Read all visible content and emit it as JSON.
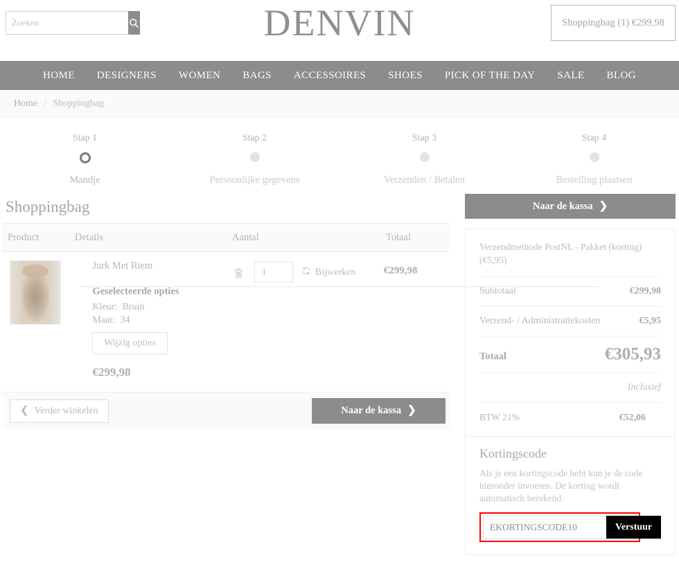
{
  "header": {
    "logo": "DENVIN",
    "search_placeholder": "Zoeken",
    "search_value": "",
    "search_icon": "search-icon",
    "bag_summary": "Shoppingbag (1) €299,98"
  },
  "nav": {
    "items": [
      {
        "label": "HOME"
      },
      {
        "label": "DESIGNERS"
      },
      {
        "label": "WOMEN"
      },
      {
        "label": "BAGS"
      },
      {
        "label": "ACCESSOIRES"
      },
      {
        "label": "SHOES"
      },
      {
        "label": "PICK OF THE DAY"
      },
      {
        "label": "SALE"
      },
      {
        "label": "BLOG"
      }
    ]
  },
  "breadcrumb": {
    "home": "Home",
    "separator": "/",
    "current": "Shoppingbag"
  },
  "steps": [
    {
      "top": "Stap 1",
      "bottom": "Mandje",
      "active": true
    },
    {
      "top": "Stap 2",
      "bottom": "Persoonlijke gegevens",
      "active": false
    },
    {
      "top": "Stap 3",
      "bottom": "Verzenden / Betalen",
      "active": false
    },
    {
      "top": "Stap 4",
      "bottom": "Bestelling plaatsen",
      "active": false
    }
  ],
  "cart": {
    "title": "Shoppingbag",
    "columns": {
      "product": "Product",
      "details": "Details",
      "amount": "Aantal",
      "total": "Totaal"
    },
    "item": {
      "name": "Jurk Met Riem",
      "options_title": "Geselecteerde opties",
      "color_label": "Kleur:",
      "color_value": "Bruin",
      "size_label": "Maat:",
      "size_value": "34",
      "edit_options_label": "Wijzig opties",
      "price": "€299,98",
      "quantity": "1",
      "update_label": "Bijwerken",
      "line_total": "€299,98",
      "remove_icon": "trash-icon",
      "update_icon": "refresh-icon",
      "thumbnail_alt": "Jurk Met Riem"
    },
    "footer": {
      "continue_label": "Verder winkelen",
      "checkout_label": "Naar de kassa"
    }
  },
  "sidebar": {
    "checkout_label": "Naar de kassa",
    "shipping_method": "Verzendmethode PostNL - Pakket (korting) (€5,95)",
    "rows": [
      {
        "label": "Subtotaal",
        "value": "€299,98"
      },
      {
        "label": "Verzend- / Administratiekosten",
        "value": "€5,95"
      }
    ],
    "total_label": "Totaal",
    "total_value": "€305,93",
    "inclusive_label": "Inclusief",
    "tax_label": "BTW 21%",
    "tax_value": "€52,06",
    "coupon": {
      "title": "Kortingscode",
      "description": "Als je een kortingscode hebt kun je de code hieronder invoeren. De korting wordt automatisch berekend.",
      "input_value": "EKORTINGSCODE10",
      "submit_label": "Verstuur",
      "highlight_color": "#ff0000"
    }
  },
  "colors": {
    "nav_bg": "#8c8c8c",
    "accent_button": "#8c8c8c",
    "coupon_button": "#000000",
    "highlight": "#ff0000"
  }
}
